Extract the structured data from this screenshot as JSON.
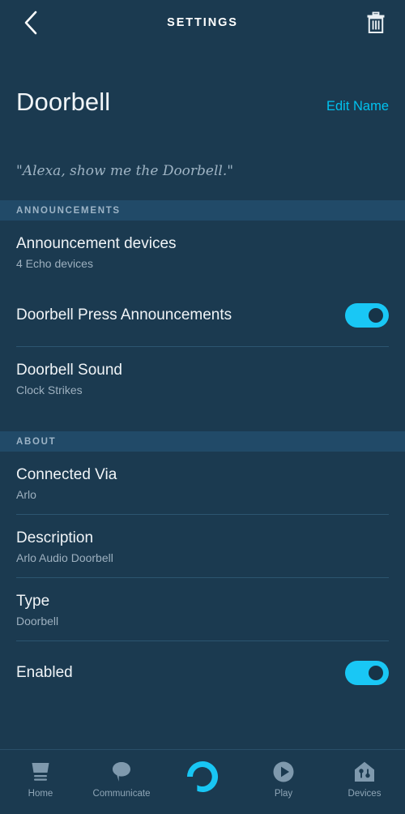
{
  "header": {
    "title": "SETTINGS",
    "back_icon": "chevron-left-icon",
    "delete_icon": "trash-icon"
  },
  "device": {
    "name": "Doorbell",
    "edit_name_label": "Edit Name",
    "utterance": "\"Alexa, show me the Doorbell.\""
  },
  "sections": [
    {
      "title": "ANNOUNCEMENTS",
      "rows": [
        {
          "title": "Announcement devices",
          "sub": "4 Echo devices",
          "control": "none"
        },
        {
          "title": "Doorbell Press Announcements",
          "sub": "",
          "control": "toggle",
          "toggle_on": true
        },
        {
          "title": "Doorbell Sound",
          "sub": "Clock Strikes",
          "control": "none"
        }
      ]
    },
    {
      "title": "ABOUT",
      "rows": [
        {
          "title": "Connected Via",
          "sub": "Arlo",
          "control": "none"
        },
        {
          "title": "Description",
          "sub": "Arlo Audio Doorbell",
          "control": "none"
        },
        {
          "title": "Type",
          "sub": "Doorbell",
          "control": "none"
        },
        {
          "title": "Enabled",
          "sub": "",
          "control": "toggle",
          "toggle_on": true
        }
      ]
    }
  ],
  "tabs": [
    {
      "label": "Home",
      "icon": "home-icon",
      "active": false
    },
    {
      "label": "Communicate",
      "icon": "speech-bubble-icon",
      "active": false
    },
    {
      "label": "",
      "icon": "alexa-ring-icon",
      "active": false
    },
    {
      "label": "Play",
      "icon": "play-circle-icon",
      "active": false
    },
    {
      "label": "Devices",
      "icon": "devices-house-icon",
      "active": false
    }
  ],
  "colors": {
    "background": "#1b3a50",
    "section_band": "#214a68",
    "accent_cyan": "#00c2ef",
    "toggle_on": "#19c7f5",
    "divider": "#2c5570",
    "text_primary": "#f0f4f7",
    "text_secondary": "#9db0bf"
  }
}
